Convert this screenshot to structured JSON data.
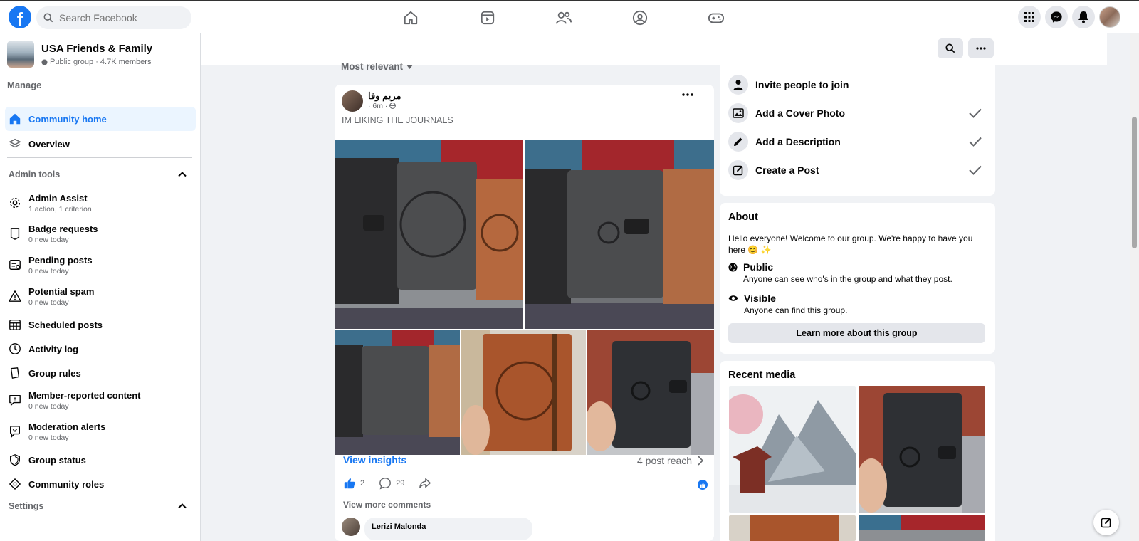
{
  "app": "Facebook",
  "topbar": {
    "search_placeholder": "Search Facebook",
    "nav_icons": [
      "home-icon",
      "video-icon",
      "friends-icon",
      "groups-icon",
      "gaming-icon"
    ],
    "right_icons": [
      "menu-grid-icon",
      "messenger-icon",
      "notifications-icon",
      "profile-avatar"
    ]
  },
  "group": {
    "name": "USA Friends & Family",
    "meta": "Public group · 4.7K members"
  },
  "sidebar": {
    "manage_label": "Manage",
    "primary": [
      {
        "label": "Community home",
        "icon": "home-icon",
        "active": true
      },
      {
        "label": "Overview",
        "icon": "layers-icon"
      }
    ],
    "admin_tools_title": "Admin tools",
    "admin_tools": [
      {
        "label": "Admin Assist",
        "sub": "1 action, 1 criterion",
        "icon": "gear-icon"
      },
      {
        "label": "Badge requests",
        "sub": "0 new today",
        "icon": "badge-icon"
      },
      {
        "label": "Pending posts",
        "sub": "0 new today",
        "icon": "pending-icon"
      },
      {
        "label": "Potential spam",
        "sub": "0 new today",
        "icon": "warning-icon"
      },
      {
        "label": "Scheduled posts",
        "sub": "",
        "icon": "calendar-icon"
      },
      {
        "label": "Activity log",
        "sub": "",
        "icon": "clock-icon"
      },
      {
        "label": "Group rules",
        "sub": "",
        "icon": "rules-icon"
      },
      {
        "label": "Member-reported content",
        "sub": "0 new today",
        "icon": "report-icon"
      },
      {
        "label": "Moderation alerts",
        "sub": "0 new today",
        "icon": "alert-icon"
      },
      {
        "label": "Group status",
        "sub": "",
        "icon": "shield-icon"
      },
      {
        "label": "Community roles",
        "sub": "",
        "icon": "diamond-icon"
      }
    ],
    "settings_title": "Settings"
  },
  "feed": {
    "sort_label": "Most relevant",
    "post": {
      "author": "مريم وفا",
      "time": "· 6m ·",
      "text": "IM LIKING THE JOURNALS",
      "insights_label": "View insights",
      "reach_label": "4 post reach",
      "likes": "2",
      "comments": "29",
      "view_more_comments": "View more comments",
      "first_commenter": "Lerizi Malonda"
    }
  },
  "right": {
    "tasks": [
      {
        "label": "Invite people to join",
        "icon": "person-icon",
        "done": false
      },
      {
        "label": "Add a Cover Photo",
        "icon": "photo-icon",
        "done": true
      },
      {
        "label": "Add a Description",
        "icon": "pencil-icon",
        "done": true
      },
      {
        "label": "Create a Post",
        "icon": "edit-icon",
        "done": true
      }
    ],
    "about": {
      "title": "About",
      "description": "Hello everyone! Welcome to our group. We're happy to have you here 😊 ✨",
      "items": [
        {
          "title": "Public",
          "sub": "Anyone can see who's in the group and what they post.",
          "icon": "globe-icon"
        },
        {
          "title": "Visible",
          "sub": "Anyone can find this group.",
          "icon": "eye-icon"
        }
      ],
      "button": "Learn more about this group"
    },
    "recent_media_title": "Recent media"
  },
  "colors": {
    "brand": "#1877f2",
    "background": "#f0f2f5",
    "secondary_text": "#65676b"
  }
}
